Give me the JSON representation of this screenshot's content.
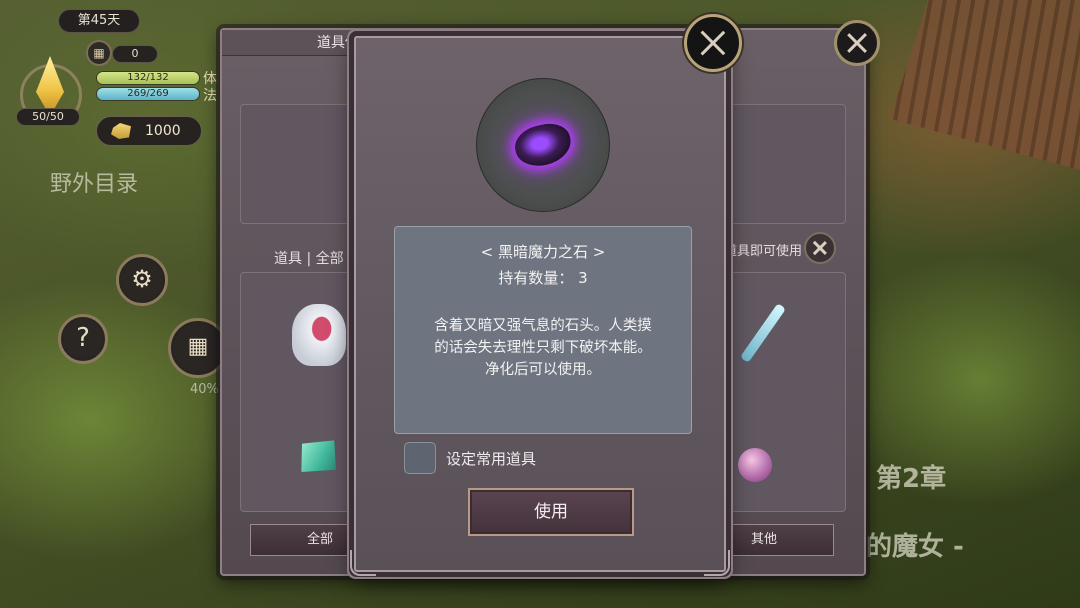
{
  "hud": {
    "day": "第45天",
    "calendar_count": "0",
    "hp_text": "132/132",
    "hp_fraction": 1.0,
    "mp_text": "269/269",
    "mp_fraction": 1.0,
    "hp_side_label": "体",
    "mp_side_label": "法",
    "crystal_value": "50/50",
    "gold": "1000",
    "progress_percent": "40%"
  },
  "background": {
    "field_menu": "野外目录",
    "chapter": "第2章",
    "chapter_subtitle": "的魔女 -"
  },
  "back_dialog": {
    "title": "道具保管箱",
    "tab_filter": "道具 | 全部",
    "hint": "道具即可使用",
    "bottom_buttons": [
      "全部",
      "其他"
    ]
  },
  "item_detail": {
    "name": "< 黑暗魔力之石 >",
    "count_label": "持有数量：",
    "count_value": "3",
    "description": "含着又暗又强气息的石头。人类摸\n的话会失去理性只剩下破坏本能。\n净化后可以使用。",
    "favorite_label": "设定常用道具",
    "use_button": "使用"
  },
  "icons": {
    "stone_glow": "#b43cff",
    "accent_gold": "#b8a37a"
  }
}
